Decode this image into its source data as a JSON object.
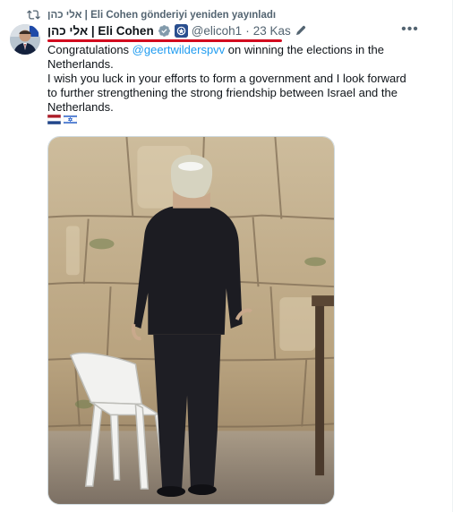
{
  "repost": {
    "icon": "repost-icon",
    "text": "אלי כהן | Eli Cohen gönderiyi yeniden yayınladı"
  },
  "author": {
    "name": "אלי כהן | Eli Cohen",
    "handle": "@elicoh1",
    "separator": "·",
    "date": "23 Kas",
    "verified_color": "#829aab"
  },
  "tweet": {
    "line1_prefix": "Congratulations ",
    "mention": "@geertwilderspvv",
    "line1_suffix": " on winning the elections in the Netherlands.",
    "line2": "I wish you luck in your efforts to form a government and I look forward to further strengthening the strong friendship between Israel and the Netherlands.",
    "flags": [
      "netherlands-flag-icon",
      "israel-flag-icon"
    ]
  },
  "colors": {
    "accent_underline": "#d20a1e",
    "link": "#1d9bf0",
    "secondary_text": "#536471"
  }
}
